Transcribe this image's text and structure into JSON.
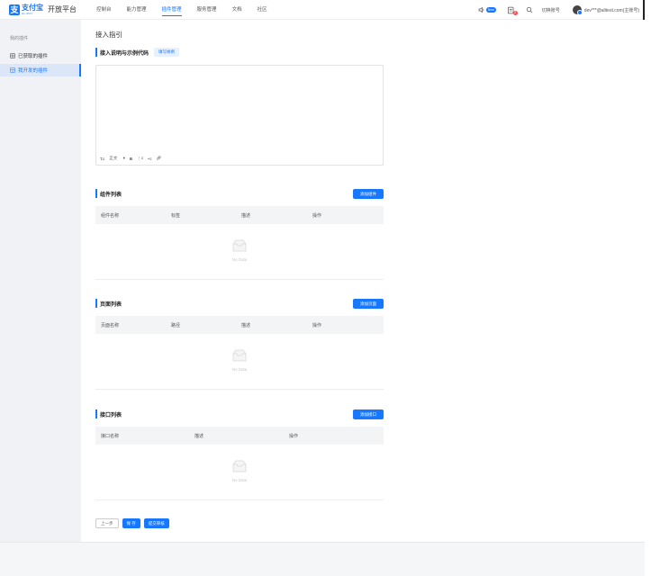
{
  "header": {
    "logo_cn": "支付宝",
    "logo_en": "ALIPAY",
    "platform": "开放平台",
    "nav": [
      "控制台",
      "能力管理",
      "插件管理",
      "服务管理",
      "文档",
      "社区"
    ],
    "active_nav_index": 2,
    "notice_tag": "New",
    "msg_badge": "2",
    "switch_account": "切换账号",
    "user": "dev***@alitest.com(主账号)"
  },
  "sidebar": {
    "title": "我的插件",
    "items": [
      {
        "label": "已获取的插件",
        "icon": "grid-icon"
      },
      {
        "label": "我开发的插件",
        "icon": "calendar-icon"
      }
    ],
    "active_index": 1
  },
  "main": {
    "title": "接入指引",
    "intro": {
      "heading": "接入说明与示例代码",
      "fill_template": "填写样例",
      "toolbar": {
        "format": "正文",
        "bold": "B"
      }
    },
    "plugin_list": {
      "heading": "组件列表",
      "add_button": "添加组件",
      "columns": [
        "组件名称",
        "标签",
        "描述",
        "操作"
      ],
      "empty": "No Data"
    },
    "page_list": {
      "heading": "页面列表",
      "add_button": "添加页面",
      "columns": [
        "页面名称",
        "路径",
        "描述",
        "操作"
      ],
      "empty": "No Data"
    },
    "api_list": {
      "heading": "接口列表",
      "add_button": "添加接口",
      "columns": [
        "接口名称",
        "描述",
        "操作"
      ],
      "empty": "No Data"
    },
    "actions": {
      "prev": "上一步",
      "save": "保 存",
      "submit": "提交审核"
    }
  },
  "colors": {
    "accent": "#1677ff",
    "sidebar_bg": "#f0f2f5",
    "table_head_bg": "#f3f4f6"
  }
}
